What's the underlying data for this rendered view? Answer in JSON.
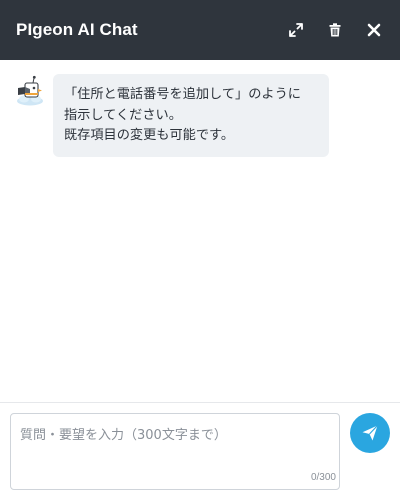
{
  "header": {
    "title": "PIgeon AI Chat",
    "icons": [
      "expand-icon",
      "trash-icon",
      "close-icon"
    ],
    "background": "#2f353d"
  },
  "messages": [
    {
      "sender": "bot",
      "avatar": "pigeon-avatar-icon",
      "text": "「住所と電話番号を追加して」のように\n指示してください。\n既存項目の変更も可能です。"
    }
  ],
  "composer": {
    "placeholder": "質問・要望を入力（300文字まで）",
    "value": "",
    "counter": "0/300",
    "send_icon": "paper-plane-icon",
    "accent": "#2aa6e0"
  }
}
